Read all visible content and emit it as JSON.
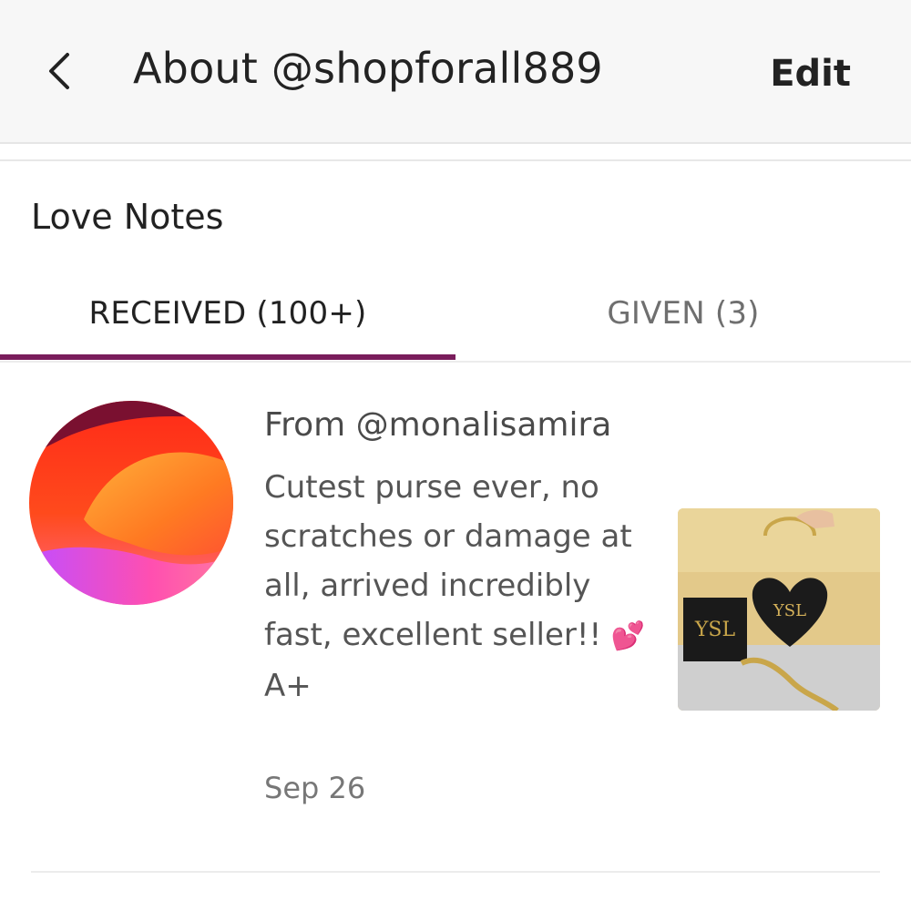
{
  "header": {
    "title": "About @shopforall889",
    "edit_label": "Edit",
    "back_icon": "chevron-left-icon"
  },
  "section": {
    "title": "Love Notes"
  },
  "tabs": [
    {
      "label": "RECEIVED (100+)",
      "active": true
    },
    {
      "label": "GIVEN (3)",
      "active": false
    }
  ],
  "colors": {
    "accent": "#7a1d5c",
    "header_bg": "#f7f7f7"
  },
  "notes": [
    {
      "from": "From @monalisamira",
      "text": "Cutest purse ever, no scratches or damage at all, arrived incredibly fast, excellent seller!!",
      "emoji": "💕",
      "grade": "A+",
      "date": "Sep 26",
      "avatar_icon": "gradient-avatar",
      "thumbnail_icon": "heart-purse-photo"
    }
  ]
}
